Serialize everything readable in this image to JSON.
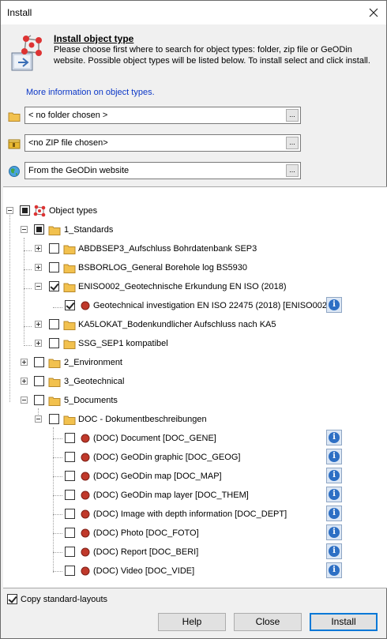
{
  "window": {
    "title": "Install"
  },
  "header": {
    "title": "Install object type",
    "description": "Please choose first where to search for object types: folder, zip file or GeODin website. Possible object types will be listed below. To install select and click install.",
    "more_link": "More information on object types."
  },
  "sources": [
    {
      "icon": "folder-icon",
      "value": "< no folder chosen >",
      "browse": "..."
    },
    {
      "icon": "zip-archive-icon",
      "value": "<no ZIP file chosen>",
      "browse": "..."
    },
    {
      "icon": "globe-icon",
      "value": "From the GeODin website",
      "browse": "..."
    }
  ],
  "tree": {
    "root": "Object types",
    "standards": "1_Standards",
    "abdbsep3": "ABDBSEP3_Aufschluss Bohrdatenbank SEP3",
    "bsborlog": "BSBORLOG_General Borehole log BS5930",
    "eniso002": "ENISO002_Geotechnische Erkundung EN ISO (2018)",
    "geotech_inv": "Geotechnical investigation EN ISO 22475 (2018) [ENISO002]",
    "ka5lokat": "KA5LOKAT_Bodenkundlicher Aufschluss nach KA5",
    "ssg_sep1": "SSG_SEP1 kompatibel",
    "environment": "2_Environment",
    "geotechnical": "3_Geotechnical",
    "documents": "5_Documents",
    "doc_folder": "DOC - Dokumentbeschreibungen",
    "doc_items": [
      "(DOC) Document [DOC_GENE]",
      "(DOC) GeODin graphic [DOC_GEOG]",
      "(DOC) GeODin map [DOC_MAP]",
      "(DOC) GeODin map layer [DOC_THEM]",
      "(DOC) Image with depth information [DOC_DEPT]",
      "(DOC) Photo [DOC_FOTO]",
      "(DOC) Report [DOC_BERI]",
      "(DOC) Video [DOC_VIDE]"
    ],
    "info_glyph": "i"
  },
  "footer": {
    "copy_layouts": "Copy standard-layouts",
    "help": "Help",
    "close": "Close",
    "install": "Install"
  },
  "colors": {
    "link": "#0b37c7",
    "info": "#2d6fc4",
    "object_dot": "#c0392b",
    "folder": "#f2c14e",
    "accent": "#0078d7"
  }
}
